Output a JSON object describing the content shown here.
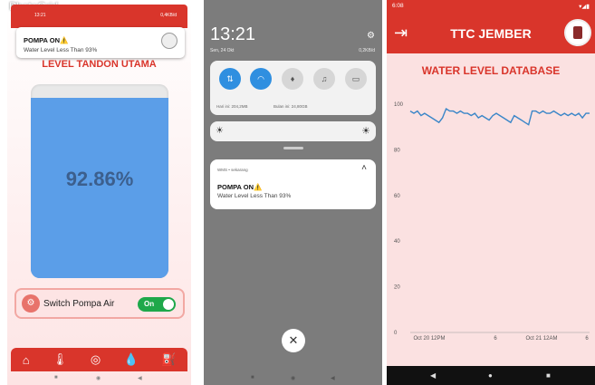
{
  "screen1": {
    "watermark": "PhotoGrid",
    "status_time": "13:21",
    "status_right": "0,4KB/d",
    "notification": {
      "title": "POMPA ON⚠️",
      "body": "Water Level Less Than 93%"
    },
    "title": "LEVEL TANDON UTAMA",
    "level_percent": "92.86%",
    "level_value": 0.9286,
    "switch_label": "Switch Pompa Air",
    "toggle_label": "On",
    "nav_icons": [
      "home-icon",
      "thermometer-icon",
      "gauge-icon",
      "drop-icon",
      "fuel-icon"
    ]
  },
  "screen2": {
    "clock": "13:21",
    "date": "Sen, 24 Okt",
    "status_right": "0,2KB/d",
    "usage_today": "Hari ini: 204,2MB",
    "usage_month": "Bulan ini: 24,80GB",
    "notif_header": "WMS • sekarang",
    "notification": {
      "title": "POMPA ON⚠️",
      "body": "Water Level Less Than 93%"
    }
  },
  "screen3": {
    "status_time": "6:08",
    "app_title": "TTC JEMBER",
    "heading": "WATER LEVEL DATABASE"
  },
  "chart_data": {
    "type": "line",
    "title": "",
    "xlabel": "",
    "ylabel": "",
    "ylim": [
      0,
      100
    ],
    "y_ticks": [
      0,
      20,
      40,
      60,
      80,
      100
    ],
    "x_ticks": [
      "Oct 20 12PM",
      "6",
      "Oct 21 12AM",
      "6"
    ],
    "grid": false,
    "series": [
      {
        "color": "#3a86c8",
        "x": [
          0,
          2,
          4,
          6,
          8,
          10,
          12,
          14,
          16,
          18,
          20,
          22,
          24,
          26,
          28,
          30,
          32,
          34,
          36,
          38,
          40,
          42,
          44,
          46,
          48,
          50,
          52,
          54,
          56,
          58,
          60,
          62,
          64,
          66,
          68,
          70,
          72,
          74,
          76,
          78,
          80,
          82,
          84,
          86,
          88,
          90,
          92,
          94,
          96,
          98,
          100
        ],
        "y": [
          97,
          96,
          97,
          95,
          96,
          95,
          94,
          93,
          92,
          94,
          98,
          97,
          97,
          96,
          97,
          96,
          96,
          95,
          96,
          94,
          95,
          94,
          93,
          95,
          96,
          95,
          94,
          93,
          92,
          95,
          94,
          93,
          92,
          91,
          97,
          97,
          96,
          97,
          96,
          96,
          97,
          96,
          95,
          96,
          95,
          96,
          95,
          96,
          94,
          96,
          96
        ]
      }
    ]
  }
}
